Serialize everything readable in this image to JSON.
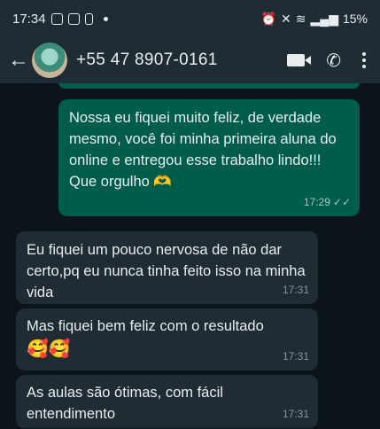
{
  "status_bar": {
    "time": "17:34",
    "battery": "15%"
  },
  "header": {
    "back_icon": "back-arrow-icon",
    "contact_name": "+55 47 8907-0161",
    "video_icon": "video-call-icon",
    "phone_icon": "phone-icon",
    "menu_icon": "more-options-icon"
  },
  "messages": [
    {
      "direction": "outgoing",
      "text": "Nossa eu fiquei muito feliz, de verdade mesmo, você foi minha primeira aluna do online e entregou esse trabalho lindo!!! Que orgulho 🫶",
      "time": "17:29",
      "status": "read"
    },
    {
      "direction": "incoming",
      "text": "Eu fiquei um pouco nervosa de não dar certo,pq eu nunca tinha feito isso na minha vida",
      "time": "17:31"
    },
    {
      "direction": "incoming",
      "text": "Mas fiquei bem feliz com o resultado",
      "emoji": "🥰🥰",
      "time": "17:31"
    },
    {
      "direction": "incoming",
      "text": "As aulas são ótimas, com fácil entendimento",
      "time": "17:31"
    }
  ]
}
